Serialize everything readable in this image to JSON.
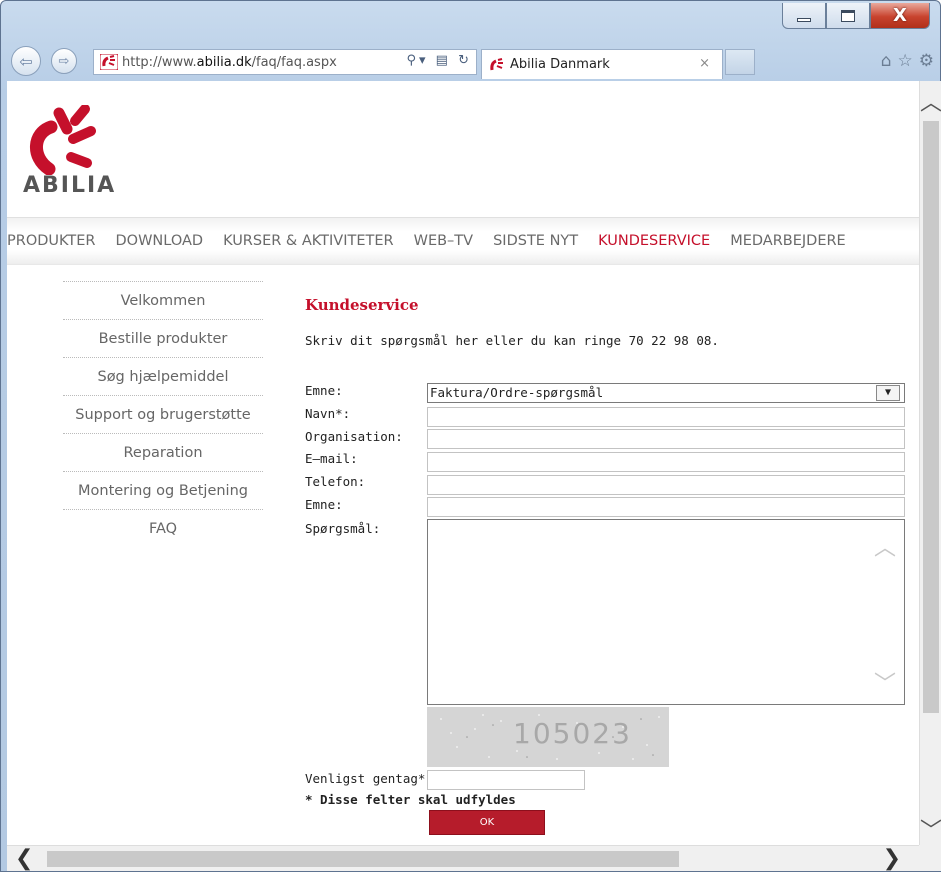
{
  "browser": {
    "address_prefix": "http://www.",
    "address_host": "abilia.dk",
    "address_path": "/faq/faq.aspx",
    "tab_title": "Abilia Danmark",
    "tab_close": "×"
  },
  "site": {
    "logo_text": "ABILIA",
    "brand_color": "#c5102b"
  },
  "menu": {
    "items": [
      "PRODUKTER",
      "DOWNLOAD",
      "KURSER & AKTIVITETER",
      "WEB–TV",
      "SIDSTE NYT",
      "KUNDESERVICE",
      "MEDARBEJDERE"
    ],
    "active": "KUNDESERVICE"
  },
  "sidebar": {
    "items": [
      "Velkommen",
      "Bestille produkter",
      "Søg hjælpemiddel",
      "Support og brugerstøtte",
      "Reparation",
      "Montering og Betjening",
      "FAQ"
    ]
  },
  "form": {
    "heading": "Kundeservice",
    "intro": "Skriv dit spørgsmål her eller du kan ringe 70 22 98 08.",
    "labels": {
      "emne_select": "Emne:",
      "navn": "Navn*:",
      "organisation": "Organisation:",
      "email": "E–mail:",
      "telefon": "Telefon:",
      "emne": "Emne:",
      "question": "Spørgsmål:",
      "repeat": "Venligst gentag*:"
    },
    "emne_selected": "Faktura/Ordre-spørgsmål",
    "captcha_value": "105023",
    "required_note": "* Disse felter skal udfyldes",
    "ok_label": "OK"
  }
}
